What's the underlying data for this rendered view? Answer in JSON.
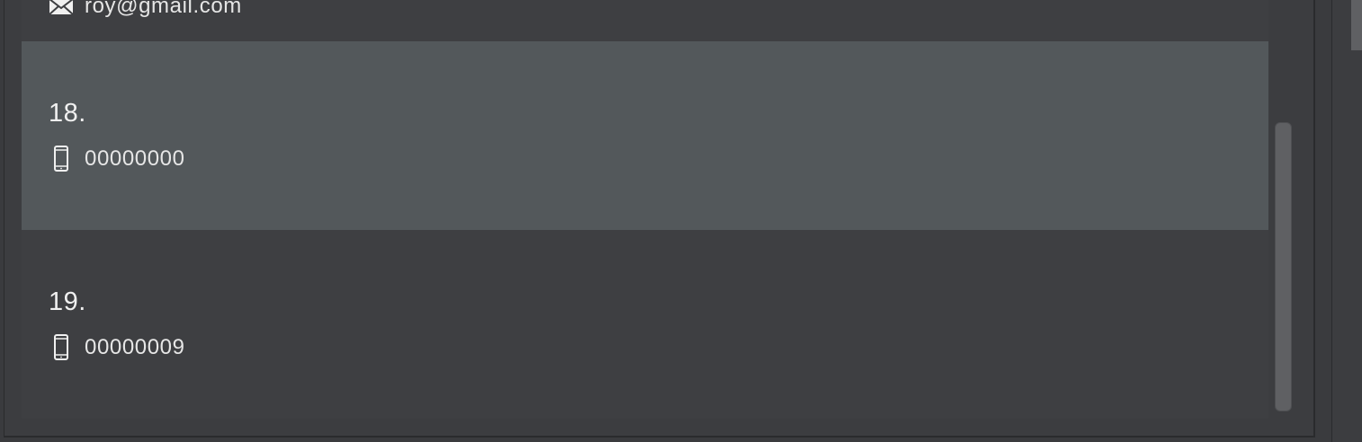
{
  "persons": [
    {
      "email": "roy@gmail.com",
      "email_icon": "envelope-icon"
    },
    {
      "index_label": "18.",
      "phone": "00000000",
      "phone_icon": "mobile-phone-icon",
      "selected": true
    },
    {
      "index_label": "19.",
      "phone": "00000009",
      "phone_icon": "mobile-phone-icon",
      "selected": false
    }
  ],
  "colors": {
    "background": "#3c3d40",
    "selected_row": "#53585b",
    "text": "#ececec"
  }
}
